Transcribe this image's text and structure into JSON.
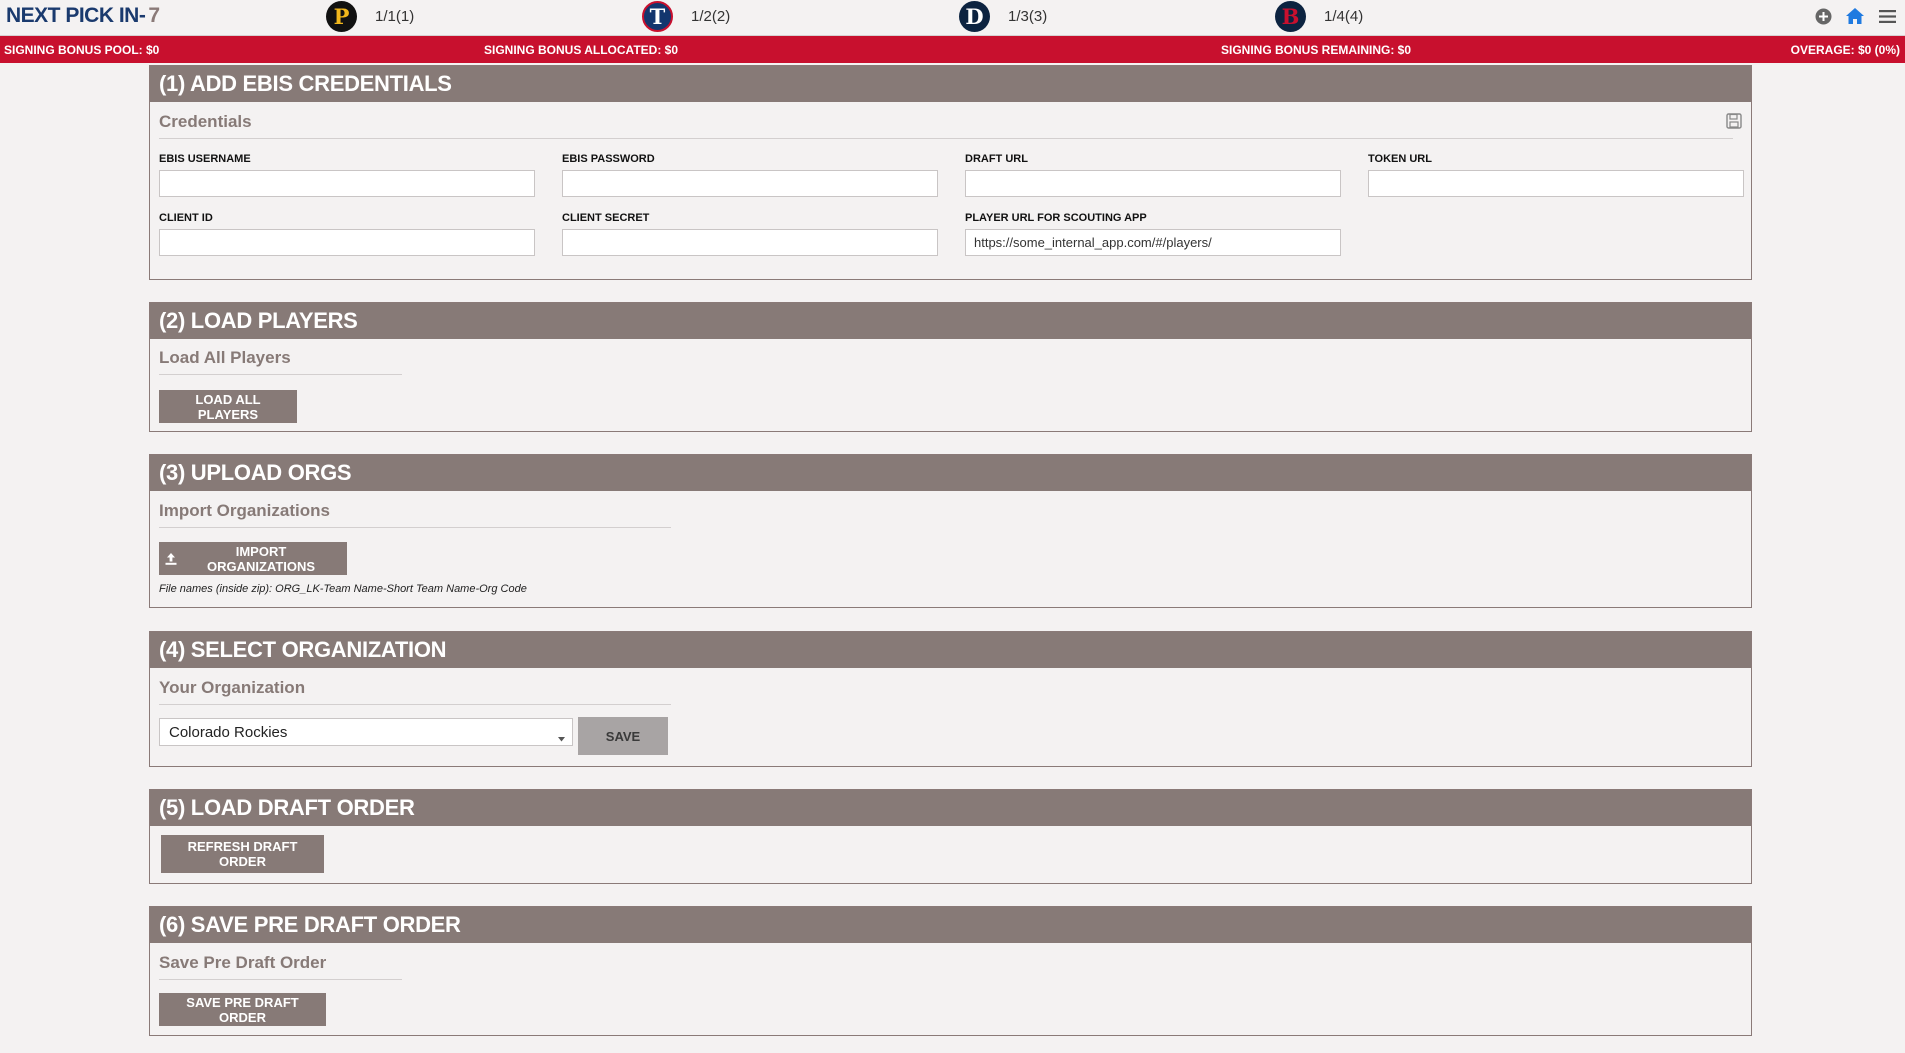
{
  "header": {
    "next_pick_label": "NEXT PICK IN-",
    "next_pick_value": "7",
    "picks": [
      {
        "letter": "P",
        "label": "1/1(1)",
        "bg": "#111111",
        "fg": "#f2b71c"
      },
      {
        "letter": "T",
        "label": "1/2(2)",
        "bg": "#13366e",
        "fg": "#ffffff"
      },
      {
        "letter": "D",
        "label": "1/3(3)",
        "bg": "#0c2340",
        "fg": "#ffffff"
      },
      {
        "letter": "B",
        "label": "1/4(4)",
        "bg": "#0c2340",
        "fg": "#c8102e"
      }
    ],
    "icons": [
      "plus-circle-icon",
      "home-icon",
      "menu-icon"
    ]
  },
  "bonus": {
    "pool": "SIGNING BONUS POOL: $0",
    "allocated": "SIGNING BONUS ALLOCATED: $0",
    "remaining": "SIGNING BONUS REMAINING: $0",
    "overage": "OVERAGE: $0 (0%)"
  },
  "s1": {
    "title": "(1) ADD EBIS CREDENTIALS",
    "sub": "Credentials",
    "fields": [
      {
        "label": "EBIS USERNAME",
        "value": ""
      },
      {
        "label": "EBIS PASSWORD",
        "value": ""
      },
      {
        "label": "DRAFT URL",
        "value": ""
      },
      {
        "label": "TOKEN URL",
        "value": ""
      },
      {
        "label": "CLIENT ID",
        "value": ""
      },
      {
        "label": "CLIENT SECRET",
        "value": ""
      },
      {
        "label": "PLAYER URL FOR SCOUTING APP",
        "value": "https://some_internal_app.com/#/players/"
      }
    ]
  },
  "s2": {
    "title": "(2) LOAD PLAYERS",
    "sub": "Load All Players",
    "button": "LOAD ALL PLAYERS"
  },
  "s3": {
    "title": "(3) UPLOAD ORGS",
    "sub": "Import Organizations",
    "button": "IMPORT ORGANIZATIONS",
    "note": "File names (inside zip): ORG_LK-Team Name-Short Team Name-Org Code"
  },
  "s4": {
    "title": "(4) SELECT ORGANIZATION",
    "sub": "Your Organization",
    "selected": "Colorado Rockies",
    "button": "SAVE"
  },
  "s5": {
    "title": "(5) LOAD DRAFT ORDER",
    "button": "REFRESH DRAFT ORDER"
  },
  "s6": {
    "title": "(6) SAVE PRE DRAFT ORDER",
    "sub": "Save Pre Draft Order",
    "button": "SAVE PRE DRAFT ORDER"
  }
}
